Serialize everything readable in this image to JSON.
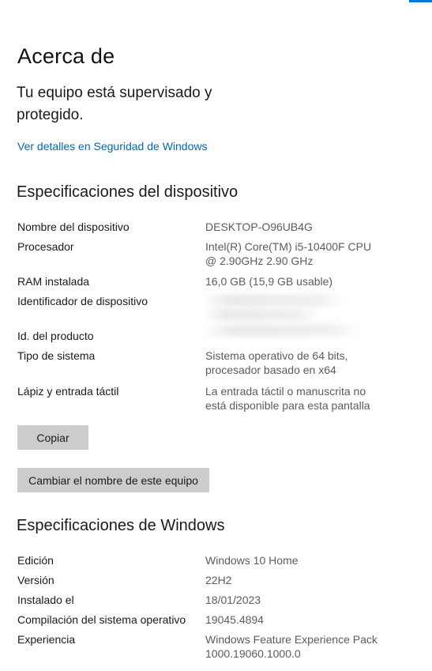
{
  "header": {
    "title": "Acerca de"
  },
  "security": {
    "status": "Tu equipo está supervisado y protegido.",
    "link": "Ver detalles en Seguridad de Windows"
  },
  "device_specs": {
    "title": "Especificaciones del dispositivo",
    "rows": [
      {
        "label": "Nombre del dispositivo",
        "value": "DESKTOP-O96UB4G"
      },
      {
        "label": "Procesador",
        "value": "Intel(R) Core(TM) i5-10400F CPU @ 2.90GHz   2.90 GHz"
      },
      {
        "label": "RAM instalada",
        "value": "16,0 GB (15,9 GB usable)"
      },
      {
        "label": "Identificador de dispositivo",
        "value": ""
      },
      {
        "label": "Id. del producto",
        "value": ""
      },
      {
        "label": "Tipo de sistema",
        "value": "Sistema operativo de 64 bits, procesador basado en x64"
      },
      {
        "label": "Lápiz y entrada táctil",
        "value": "La entrada táctil o manuscrita no está disponible para esta pantalla"
      }
    ],
    "copy_button": "Copiar",
    "rename_button": "Cambiar el nombre de este equipo"
  },
  "windows_specs": {
    "title": "Especificaciones de Windows",
    "rows": [
      {
        "label": "Edición",
        "value": "Windows 10 Home"
      },
      {
        "label": "Versión",
        "value": "22H2"
      },
      {
        "label": "Instalado el",
        "value": "18/01/2023"
      },
      {
        "label": "Compilación del sistema operativo",
        "value": "19045.4894"
      },
      {
        "label": "Experiencia",
        "value": "Windows Feature Experience Pack 1000.19060.1000.0"
      }
    ]
  },
  "colors": {
    "accent": "#0078d7",
    "link": "#0067c0",
    "button_bg": "#cccccc"
  }
}
